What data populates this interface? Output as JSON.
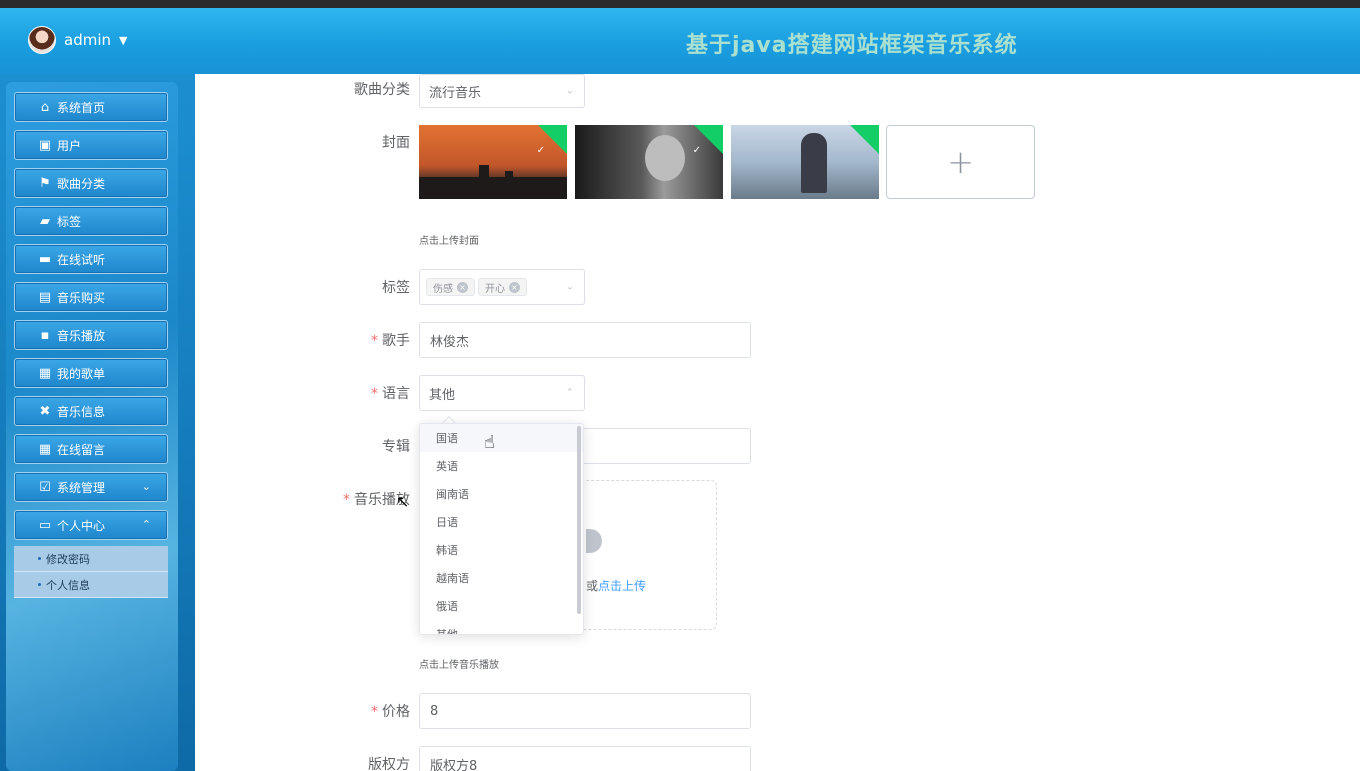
{
  "header": {
    "username": "admin",
    "title": "基于java搭建网站框架音乐系统"
  },
  "sidebar": {
    "items": [
      {
        "label": "系统首页",
        "icon": "home-icon"
      },
      {
        "label": "用户",
        "icon": "user-card-icon"
      },
      {
        "label": "歌曲分类",
        "icon": "flag-icon"
      },
      {
        "label": "标签",
        "icon": "wallet-icon"
      },
      {
        "label": "在线试听",
        "icon": "briefcase-icon"
      },
      {
        "label": "音乐购买",
        "icon": "clipboard-icon"
      },
      {
        "label": "音乐播放",
        "icon": "chat-icon"
      },
      {
        "label": "我的歌单",
        "icon": "grid-icon"
      },
      {
        "label": "音乐信息",
        "icon": "ticket-icon"
      },
      {
        "label": "在线留言",
        "icon": "grid-icon"
      },
      {
        "label": "系统管理",
        "icon": "clipboard-check-icon"
      },
      {
        "label": "个人中心",
        "icon": "card-icon"
      }
    ],
    "submenu": [
      "修改密码",
      "个人信息"
    ]
  },
  "form": {
    "category_label": "歌曲分类",
    "category_value": "流行音乐",
    "cover_label": "封面",
    "cover_hint": "点击上传封面",
    "tags_label": "标签",
    "tags": [
      "伤感",
      "开心"
    ],
    "singer_label": "歌手",
    "singer_value": "林俊杰",
    "language_label": "语言",
    "language_value": "其他",
    "album_label": "专辑",
    "music_label": "音乐播放",
    "upload_text_prefix": "或",
    "upload_text_link": "点击上传",
    "music_hint": "点击上传音乐播放",
    "price_label": "价格",
    "price_value": "8",
    "copyright_label": "版权方",
    "copyright_value": "版权方8"
  },
  "language_options": [
    "国语",
    "英语",
    "闽南语",
    "日语",
    "韩语",
    "越南语",
    "俄语",
    "其他"
  ],
  "colors": {
    "header_blue": "#1a9ee0",
    "title_green": "#a9e0cf",
    "required": "#f56c6c",
    "link": "#409eff",
    "selected_badge": "#13ce66"
  }
}
